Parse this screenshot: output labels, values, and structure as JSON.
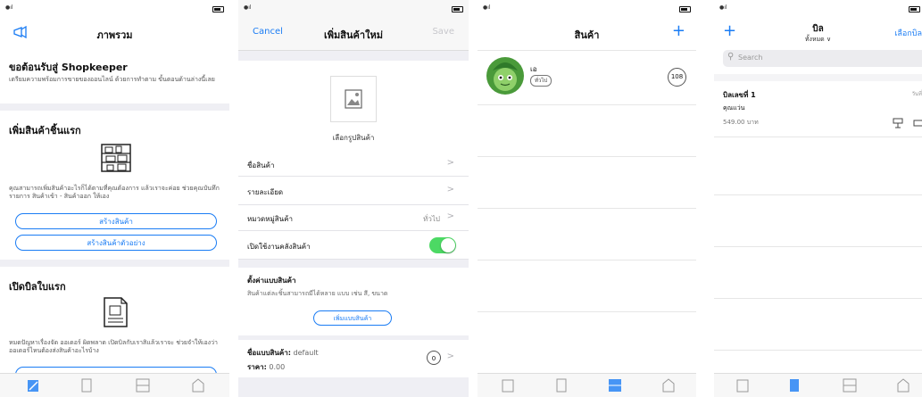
{
  "screen1": {
    "title": "ภาพรวม",
    "welcome": "ขอต้อนรับสู่ Shopkeeper",
    "welcome_desc": "เตรียมความพร้อมการขายของออนไลน์ ด้วยการทำตาม ขั้นตอนด้านล่างนี้เลย",
    "section_product_title": "เพิ่มสินค้าชิ้นแรก",
    "section_product_desc": "คุณสามารถเพิ่มสินค้าอะไรก็ได้ตามที่คุณต้องการ แล้วเราจะค่อย ช่วยคุณบันทึกรายการ สินค้าเข้า - สินค้าออก ให้เอง",
    "create_product": "สร้างสินค้า",
    "create_sample_product": "สร้างสินค้าตัวอย่าง",
    "section_bill_title": "เปิดบิลใบแรก",
    "section_bill_desc": "หมดปัญหาเรื่องจัด ออเดอร์ ผิดพลาด เปิดบิลกับเราสิแล้วเราจะ ช่วยจำให้เองว่า ออเดอร์ไหนต้องส่งสินค้าอะไรบ้าง"
  },
  "screen2": {
    "cancel": "Cancel",
    "title": "เพิ่มสินค้าใหม่",
    "save": "Save",
    "pick_image": "เลือกรูปสินค้า",
    "product_name": "ชื่อสินค้า",
    "details": "รายละเอียด",
    "category_label": "หมวดหมู่สินค้า",
    "category_value": "ทั่วไป",
    "enable_stock": "เปิดใช้งานคลังสินค้า",
    "variant_title": "ตั้งค่าแบบสินค้า",
    "variant_desc": "สินค้าแต่ละชิ้นสามารถมีได้หลาย แบบ เช่น สี, ขนาด",
    "add_variant": "เพิ่มแบบสินค้า",
    "variant_name_label": "ชื่อแบบสินค้า:",
    "variant_name_value": "default",
    "price_label": "ราคา:",
    "price_value": "0.00",
    "qty": "0"
  },
  "screen3": {
    "title": "สินค้า",
    "add": "+",
    "item_name": "เอ",
    "item_tag": "ทั่วไป",
    "item_count": "108"
  },
  "screen4": {
    "add": "+",
    "title": "บิล",
    "subtitle": "ทั้งหมด ∨",
    "select": "เลือกบิล",
    "search_placeholder": "Search",
    "bill_no": "บิลเลขที่ 1",
    "bill_date": "วันที่",
    "customer": "คุณแว่น",
    "amount": "549.00 บาท"
  }
}
